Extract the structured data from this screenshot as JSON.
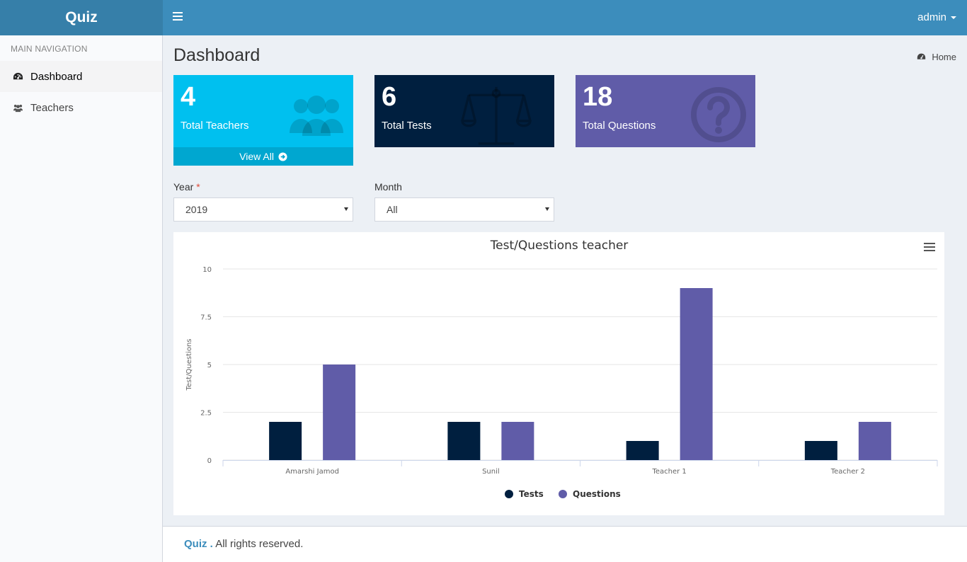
{
  "app": {
    "logo": "Quiz"
  },
  "header": {
    "user": "admin"
  },
  "sidebar": {
    "header": "MAIN NAVIGATION",
    "items": [
      {
        "label": "Dashboard",
        "icon": "dashboard-icon",
        "active": true
      },
      {
        "label": "Teachers",
        "icon": "users-icon",
        "active": false
      }
    ]
  },
  "page": {
    "title": "Dashboard",
    "breadcrumb": "Home"
  },
  "stats": [
    {
      "value": "4",
      "label": "Total Teachers",
      "color": "#00c0ef",
      "icon": "users-icon",
      "footer": "View All"
    },
    {
      "value": "6",
      "label": "Total Tests",
      "color": "#001f3f",
      "icon": "balance-scale-icon"
    },
    {
      "value": "18",
      "label": "Total Questions",
      "color": "#605ca8",
      "icon": "question-circle-icon"
    }
  ],
  "filters": {
    "year": {
      "label": "Year",
      "required_mark": "*",
      "value": "2019"
    },
    "month": {
      "label": "Month",
      "value": "All"
    }
  },
  "chart_data": {
    "type": "bar",
    "title": "Test/Questions teacher",
    "xlabel": "",
    "ylabel": "Test/Questions",
    "categories": [
      "Amarshi Jamod",
      "Sunil",
      "Teacher 1",
      "Teacher 2"
    ],
    "series": [
      {
        "name": "Tests",
        "values": [
          2,
          2,
          1,
          1
        ],
        "color": "#001f3f"
      },
      {
        "name": "Questions",
        "values": [
          5,
          2,
          9,
          2
        ],
        "color": "#605ca8"
      }
    ],
    "ylim": [
      0,
      10
    ],
    "yticks": [
      "0",
      "2.5",
      "5",
      "7.5",
      "10"
    ],
    "ytick_values": [
      0,
      2.5,
      5,
      7.5,
      10
    ],
    "grid": true,
    "legend_position": "bottom-center"
  },
  "footer": {
    "brand": "Quiz .",
    "text": "All rights reserved."
  }
}
